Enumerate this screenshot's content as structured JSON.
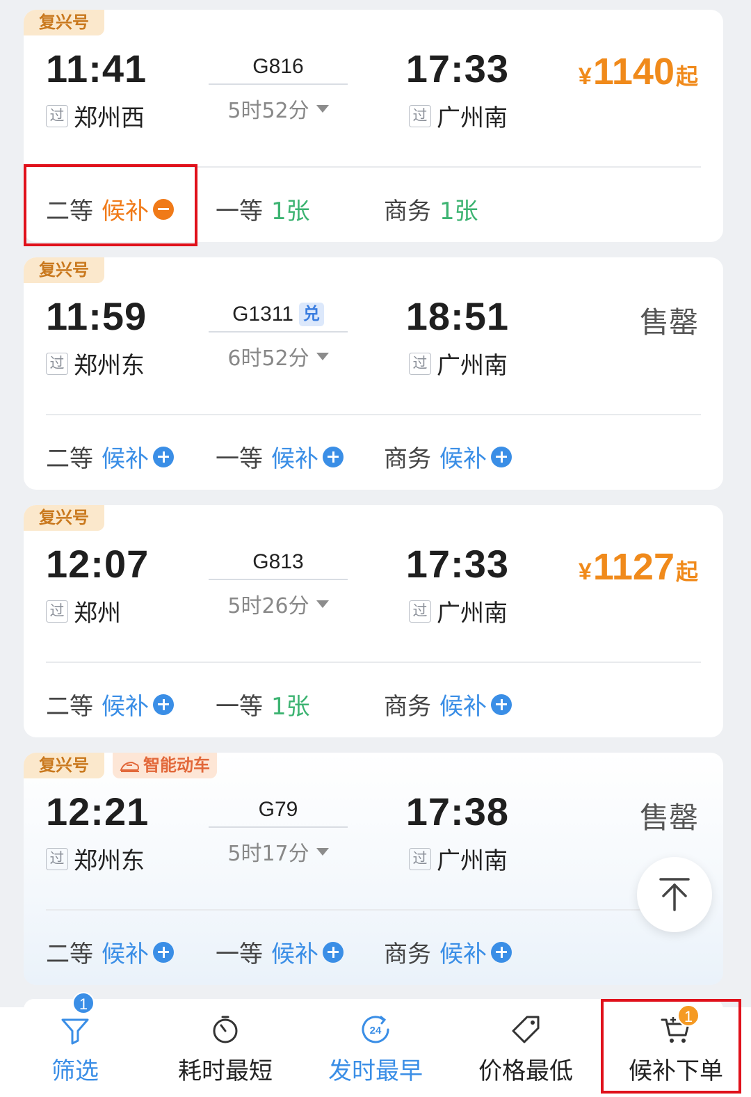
{
  "trains": [
    {
      "tags": [
        "复兴号"
      ],
      "dep_time": "11:41",
      "dep_pass": "过",
      "dep_station": "郑州西",
      "train_no": "G816",
      "duration": "5时52分",
      "arr_time": "17:33",
      "arr_pass": "过",
      "arr_station": "广州南",
      "price_symbol": "¥",
      "price_amount": "1140",
      "price_suffix": "起",
      "seats": [
        {
          "cls": "二等",
          "avail": "候补"
        },
        {
          "cls": "一等",
          "avail": "1张"
        },
        {
          "cls": "商务",
          "avail": "1张"
        }
      ]
    },
    {
      "tags": [
        "复兴号"
      ],
      "dep_time": "11:59",
      "dep_pass": "过",
      "dep_station": "郑州东",
      "train_no": "G1311",
      "exchange_badge": "兑",
      "duration": "6时52分",
      "arr_time": "18:51",
      "arr_pass": "过",
      "arr_station": "广州南",
      "status": "售罄",
      "seats": [
        {
          "cls": "二等",
          "avail": "候补"
        },
        {
          "cls": "一等",
          "avail": "候补"
        },
        {
          "cls": "商务",
          "avail": "候补"
        }
      ]
    },
    {
      "tags": [
        "复兴号"
      ],
      "dep_time": "12:07",
      "dep_pass": "过",
      "dep_station": "郑州",
      "train_no": "G813",
      "duration": "5时26分",
      "arr_time": "17:33",
      "arr_pass": "过",
      "arr_station": "广州南",
      "price_symbol": "¥",
      "price_amount": "1127",
      "price_suffix": "起",
      "seats": [
        {
          "cls": "二等",
          "avail": "候补"
        },
        {
          "cls": "一等",
          "avail": "1张"
        },
        {
          "cls": "商务",
          "avail": "候补"
        }
      ]
    },
    {
      "tags": [
        "复兴号",
        "智能动车"
      ],
      "dep_time": "12:21",
      "dep_pass": "过",
      "dep_station": "郑州东",
      "train_no": "G79",
      "duration": "5时17分",
      "arr_time": "17:38",
      "arr_pass": "过",
      "arr_station": "广州南",
      "status": "售罄",
      "seats": [
        {
          "cls": "二等",
          "avail": "候补"
        },
        {
          "cls": "一等",
          "avail": "候补"
        },
        {
          "cls": "商务",
          "avail": "候补"
        }
      ]
    }
  ],
  "bottom_bar": {
    "filter": {
      "label": "筛选",
      "badge": "1",
      "icon": "filter-icon"
    },
    "shortest": {
      "label": "耗时最短",
      "icon": "stopwatch-icon"
    },
    "earliest": {
      "label": "发时最早",
      "icon": "24h-clock-icon",
      "icon_text": "24"
    },
    "cheapest": {
      "label": "价格最低",
      "icon": "price-tag-icon"
    },
    "waitlist": {
      "label": "候补下单",
      "badge": "1",
      "icon": "cart-icon"
    }
  },
  "colors": {
    "price": "#f08a1b",
    "available": "#3cb371",
    "waitlist_blue": "#3a8ee6",
    "waitlist_selected": "#f07a18",
    "tag_bg": "#fbe8cc",
    "highlight": "#e0111b"
  }
}
